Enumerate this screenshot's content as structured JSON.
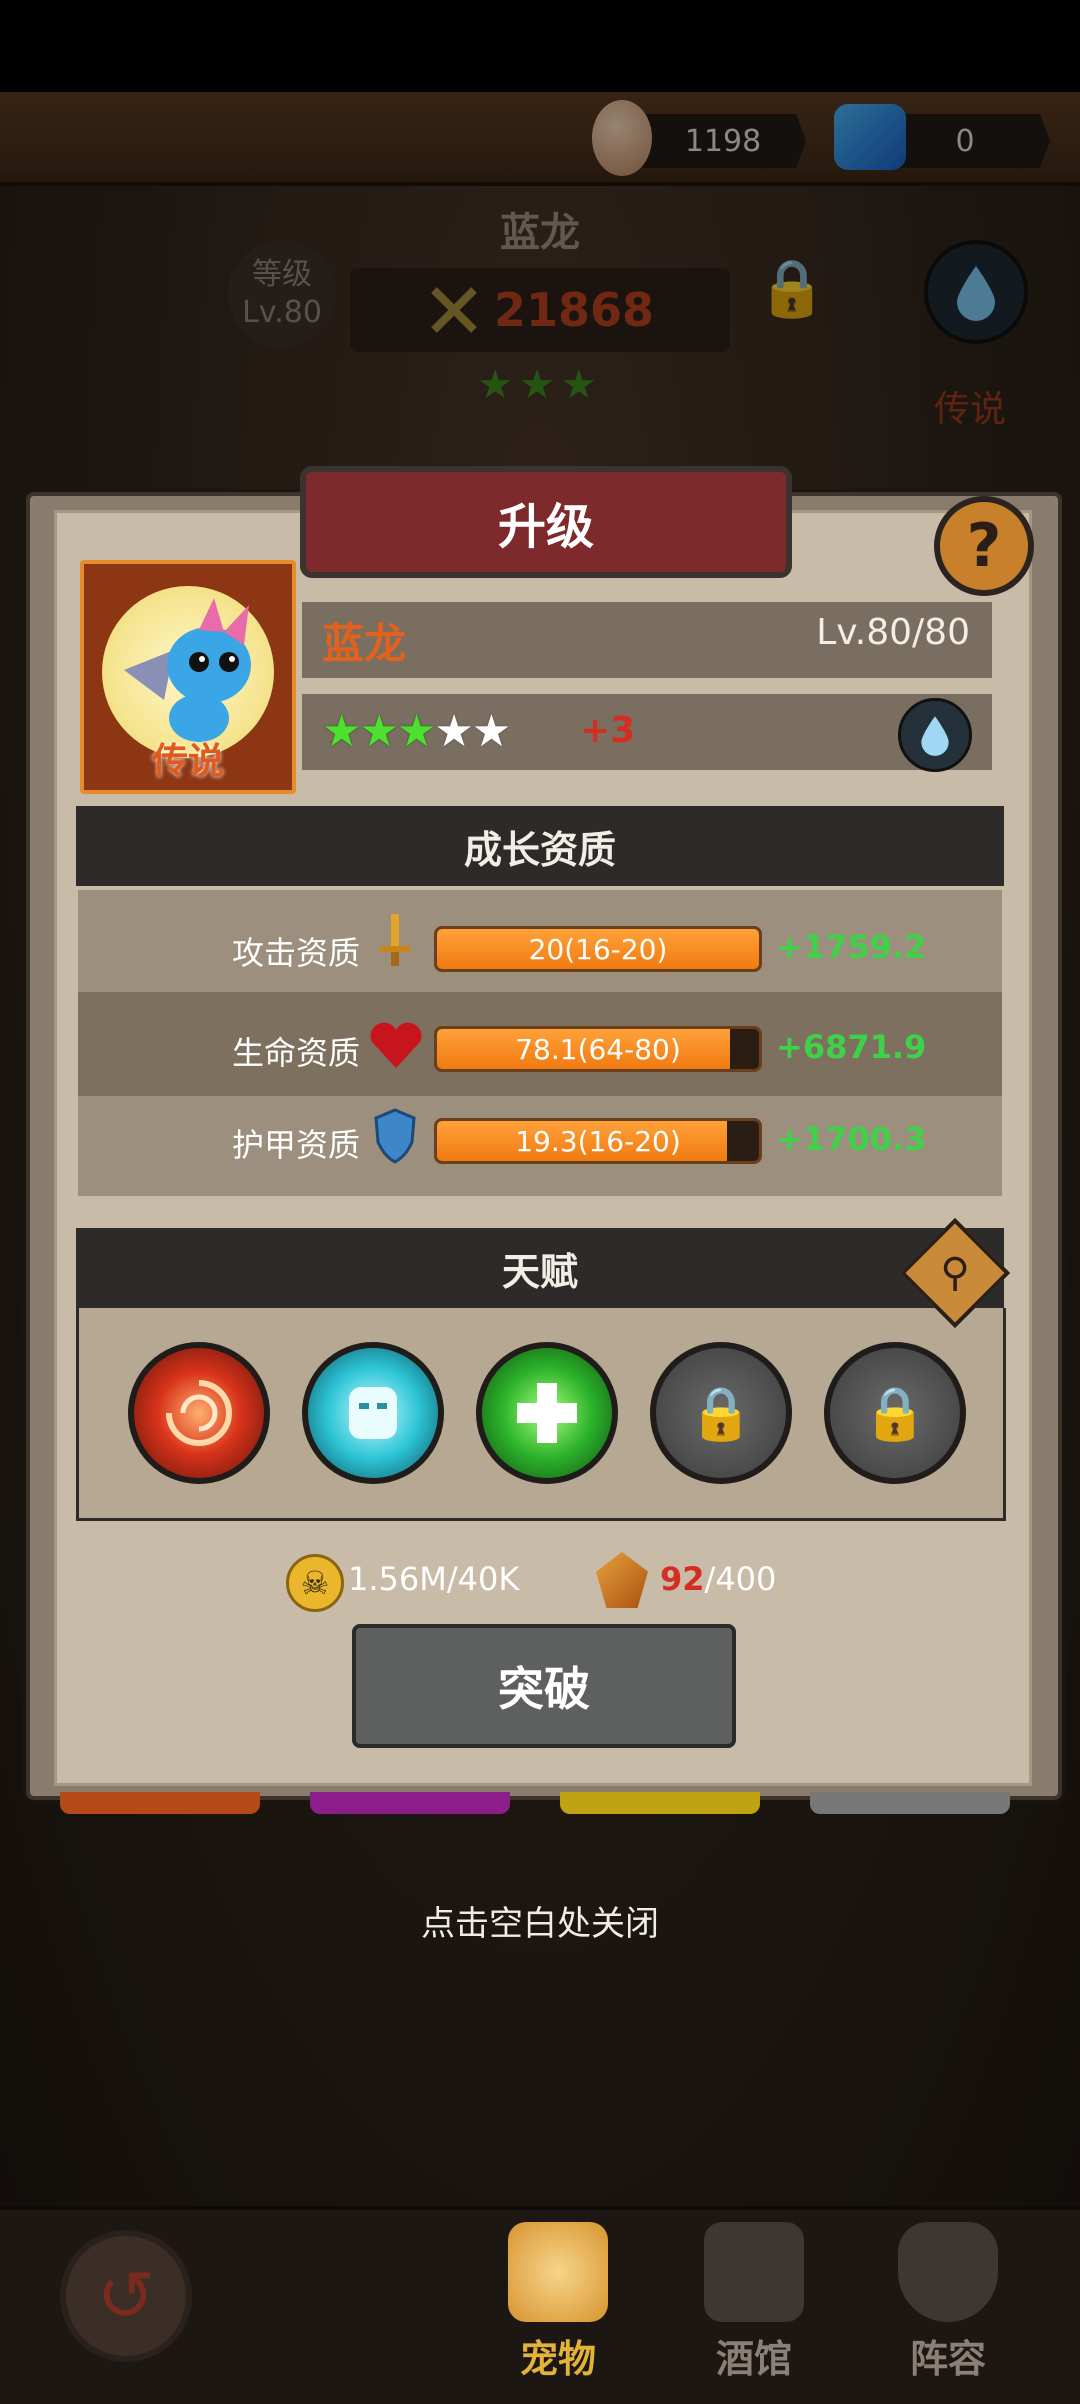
{
  "topbar": {
    "egg_count": "1198",
    "gem_count": "0"
  },
  "background_header": {
    "pet_name": "蓝龙",
    "level_label": "等级",
    "level_value": "Lv.80",
    "power": "21868",
    "stars": "★★★",
    "rarity": "传说"
  },
  "dialog": {
    "title": "升级",
    "help_symbol": "?",
    "portrait_label": "传说",
    "pet_name": "蓝龙",
    "level": "Lv.80/80",
    "stars_filled": "★★★",
    "stars_empty": "★★",
    "star_bonus": "+3",
    "growth": {
      "header": "成长资质",
      "rows": [
        {
          "label": "攻击资质",
          "icon": "sword-icon",
          "value_text": "20(16-20)",
          "fill": 1.0,
          "bonus": "+1759.2"
        },
        {
          "label": "生命资质",
          "icon": "heart-icon",
          "value_text": "78.1(64-80)",
          "fill": 0.91,
          "bonus": "+6871.9"
        },
        {
          "label": "护甲资质",
          "icon": "shield-icon",
          "value_text": "19.3(16-20)",
          "fill": 0.9,
          "bonus": "+1700.3"
        }
      ]
    },
    "talent": {
      "header": "天赋",
      "slots": [
        {
          "name": "fire-vortex-icon",
          "locked": false
        },
        {
          "name": "ice-golem-icon",
          "locked": false
        },
        {
          "name": "heal-cross-icon",
          "locked": false
        },
        {
          "name": "lock-icon",
          "locked": true
        },
        {
          "name": "lock-icon",
          "locked": true
        }
      ]
    },
    "cost": {
      "gold": "1.56M/40K",
      "crystal_current": "92",
      "crystal_total": "/400"
    },
    "breakthrough_button": "突破"
  },
  "close_hint": "点击空白处关闭",
  "bottom_nav": {
    "items": [
      {
        "label": "宠物",
        "icon": "hamster-icon",
        "color": "#e0a52a"
      },
      {
        "label": "酒馆",
        "icon": "tavern-icon",
        "color": "#6b6157"
      },
      {
        "label": "阵容",
        "icon": "formation-shield-icon",
        "color": "#6b6157"
      }
    ]
  },
  "colors": {
    "accent_orange": "#e2611d",
    "bonus_green": "#3fd14a",
    "title_banner": "#7e2a2c"
  }
}
